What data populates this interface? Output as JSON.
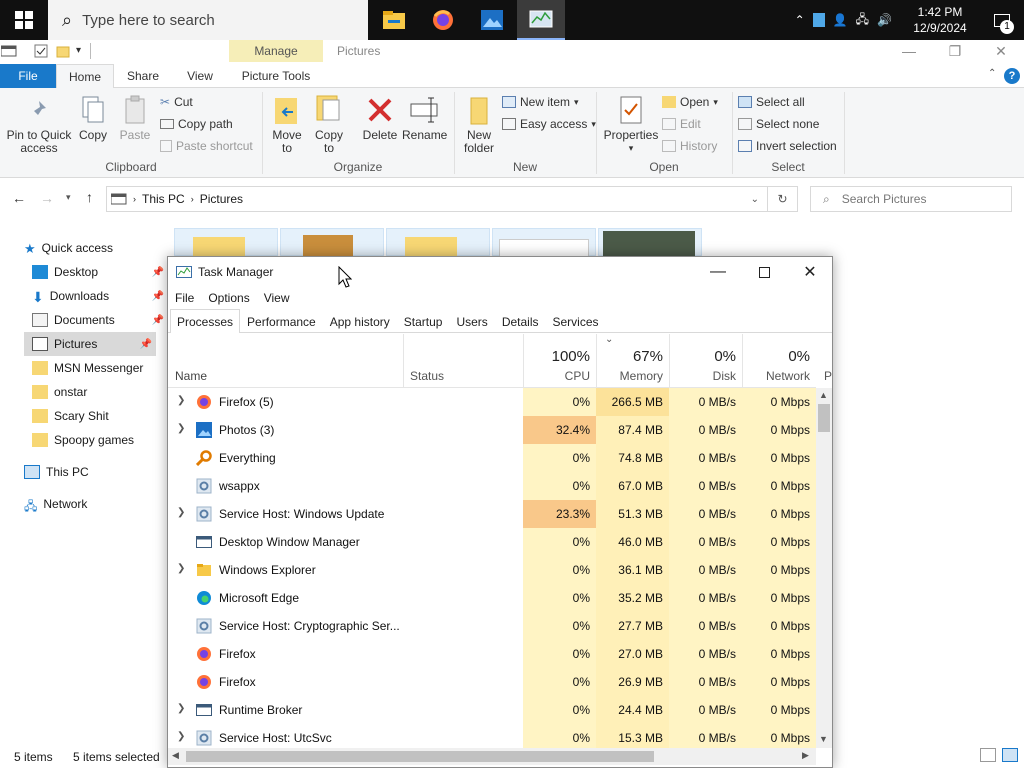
{
  "taskbar": {
    "search_placeholder": "Type here to search",
    "time": "1:42 PM",
    "date": "12/9/2024",
    "notification_count": "1"
  },
  "explorer": {
    "context_tab": "Manage",
    "window_title": "Pictures",
    "tabs": [
      "File",
      "Home",
      "Share",
      "View",
      "Picture Tools"
    ],
    "ribbon": {
      "pin": "Pin to Quick",
      "pin2": "access",
      "copy": "Copy",
      "paste": "Paste",
      "cut": "Cut",
      "copy_path": "Copy path",
      "paste_shortcut": "Paste shortcut",
      "clipboard": "Clipboard",
      "move_to": "Move",
      "move_to2": "to",
      "copy_to": "Copy",
      "copy_to2": "to",
      "delete": "Delete",
      "rename": "Rename",
      "organize": "Organize",
      "new_folder": "New",
      "new_folder2": "folder",
      "new_item": "New item",
      "easy_access": "Easy access",
      "new_group": "New",
      "properties": "Properties",
      "open": "Open",
      "edit": "Edit",
      "history": "History",
      "open_group": "Open",
      "select_all": "Select all",
      "select_none": "Select none",
      "invert_selection": "Invert selection",
      "select_group": "Select"
    },
    "address": {
      "crumb1": "This PC",
      "crumb2": "Pictures",
      "search_placeholder": "Search Pictures"
    },
    "nav": [
      {
        "label": "Quick access"
      },
      {
        "label": "Desktop"
      },
      {
        "label": "Downloads"
      },
      {
        "label": "Documents"
      },
      {
        "label": "Pictures"
      },
      {
        "label": "MSN Messenger"
      },
      {
        "label": "onstar"
      },
      {
        "label": "Scary Shit"
      },
      {
        "label": "Spoopy games"
      },
      {
        "label": "This PC"
      },
      {
        "label": "Network"
      }
    ],
    "status": {
      "items": "5 items",
      "selected": "5 items selected"
    }
  },
  "taskmanager": {
    "title": "Task Manager",
    "menu": [
      "File",
      "Options",
      "View"
    ],
    "tabs": [
      "Processes",
      "Performance",
      "App history",
      "Startup",
      "Users",
      "Details",
      "Services"
    ],
    "columns": {
      "name": "Name",
      "status": "Status",
      "cpu_pct": "100%",
      "cpu": "CPU",
      "mem_pct": "67%",
      "mem": "Memory",
      "disk_pct": "0%",
      "disk": "Disk",
      "net_pct": "0%",
      "net": "Network",
      "power": "P"
    },
    "processes": [
      {
        "name": "Firefox (5)",
        "cpu": "0%",
        "mem": "266.5 MB",
        "disk": "0 MB/s",
        "net": "0 Mbps",
        "expandable": true,
        "icon": "firefox-icon"
      },
      {
        "name": "Photos (3)",
        "cpu": "32.4%",
        "mem": "87.4 MB",
        "disk": "0 MB/s",
        "net": "0 Mbps",
        "expandable": true,
        "icon": "photos-icon"
      },
      {
        "name": "Everything",
        "cpu": "0%",
        "mem": "74.8 MB",
        "disk": "0 MB/s",
        "net": "0 Mbps",
        "expandable": false,
        "icon": "search-magnifier-icon"
      },
      {
        "name": "wsappx",
        "cpu": "0%",
        "mem": "67.0 MB",
        "disk": "0 MB/s",
        "net": "0 Mbps",
        "expandable": false,
        "icon": "gear-icon"
      },
      {
        "name": "Service Host: Windows Update",
        "cpu": "23.3%",
        "mem": "51.3 MB",
        "disk": "0 MB/s",
        "net": "0 Mbps",
        "expandable": true,
        "icon": "gear-icon"
      },
      {
        "name": "Desktop Window Manager",
        "cpu": "0%",
        "mem": "46.0 MB",
        "disk": "0 MB/s",
        "net": "0 Mbps",
        "expandable": false,
        "icon": "window-icon"
      },
      {
        "name": "Windows Explorer",
        "cpu": "0%",
        "mem": "36.1 MB",
        "disk": "0 MB/s",
        "net": "0 Mbps",
        "expandable": true,
        "icon": "folder-icon"
      },
      {
        "name": "Microsoft Edge",
        "cpu": "0%",
        "mem": "35.2 MB",
        "disk": "0 MB/s",
        "net": "0 Mbps",
        "expandable": false,
        "icon": "edge-icon"
      },
      {
        "name": "Service Host: Cryptographic Ser...",
        "cpu": "0%",
        "mem": "27.7 MB",
        "disk": "0 MB/s",
        "net": "0 Mbps",
        "expandable": false,
        "icon": "gear-icon"
      },
      {
        "name": "Firefox",
        "cpu": "0%",
        "mem": "27.0 MB",
        "disk": "0 MB/s",
        "net": "0 Mbps",
        "expandable": false,
        "icon": "firefox-icon"
      },
      {
        "name": "Firefox",
        "cpu": "0%",
        "mem": "26.9 MB",
        "disk": "0 MB/s",
        "net": "0 Mbps",
        "expandable": false,
        "icon": "firefox-icon"
      },
      {
        "name": "Runtime Broker",
        "cpu": "0%",
        "mem": "24.4 MB",
        "disk": "0 MB/s",
        "net": "0 Mbps",
        "expandable": true,
        "icon": "window-icon"
      },
      {
        "name": "Service Host: UtcSvc",
        "cpu": "0%",
        "mem": "15.3 MB",
        "disk": "0 MB/s",
        "net": "0 Mbps",
        "expandable": true,
        "icon": "gear-icon"
      }
    ]
  },
  "colors": {
    "cpu_high": "#f9c88a",
    "cpu_low": "#fff4c4",
    "mem_high": "#fce29a",
    "mem": "#fff0b8",
    "cell": "#fff4c4",
    "accent": "#1979ca"
  }
}
